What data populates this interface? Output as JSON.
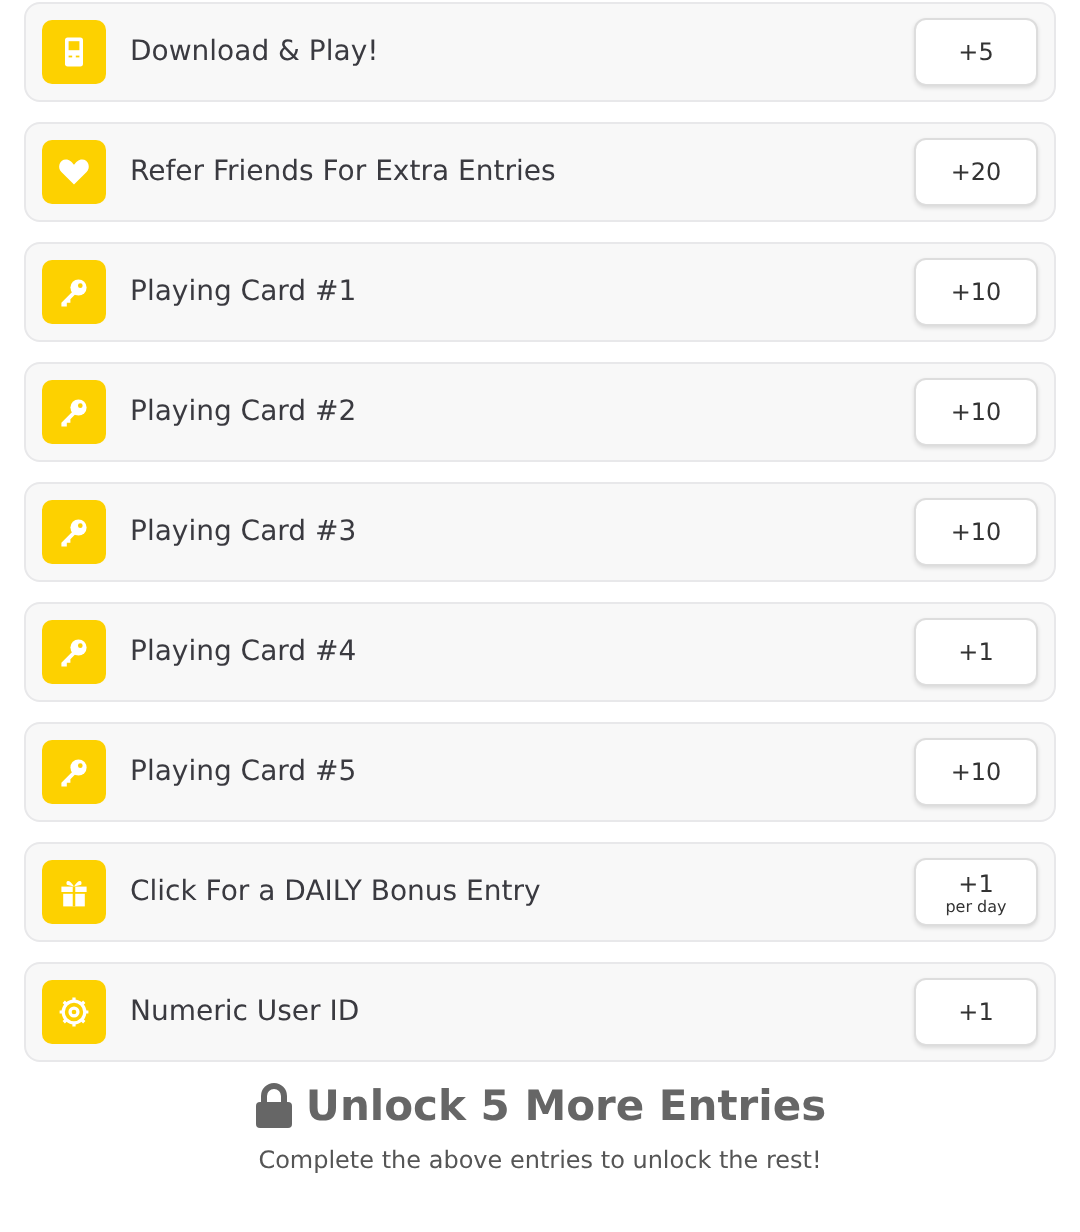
{
  "entries": [
    {
      "kind": "play",
      "label": "Download & Play!",
      "points": "+5"
    },
    {
      "kind": "refer",
      "label": "Refer Friends For Extra Entries",
      "points": "+20"
    },
    {
      "kind": "card",
      "label": "Playing Card #1",
      "points": "+10"
    },
    {
      "kind": "card",
      "label": "Playing Card #2",
      "points": "+10"
    },
    {
      "kind": "card",
      "label": "Playing Card #3",
      "points": "+10"
    },
    {
      "kind": "card",
      "label": "Playing Card #4",
      "points": "+1"
    },
    {
      "kind": "card",
      "label": "Playing Card #5",
      "points": "+10"
    },
    {
      "kind": "bonus",
      "label": "Click For a DAILY Bonus Entry",
      "points": "+1",
      "note": "per day"
    },
    {
      "kind": "userid",
      "label": "Numeric User ID",
      "points": "+1"
    }
  ],
  "locked": {
    "title": "Unlock 5 More Entries",
    "subtitle": "Complete the above entries to unlock the rest!"
  }
}
